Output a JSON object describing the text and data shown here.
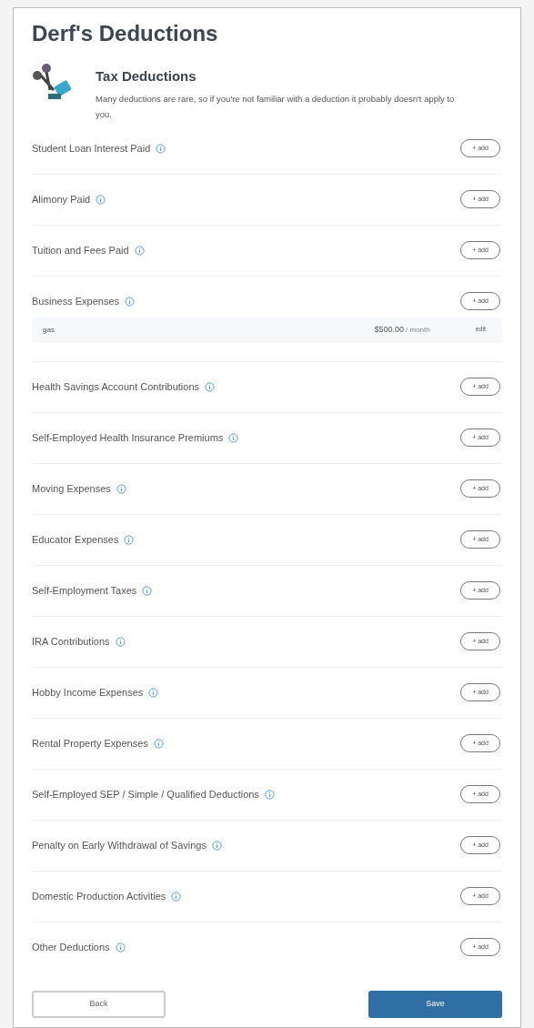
{
  "title": "Derf's Deductions",
  "section": {
    "title": "Tax Deductions",
    "description": "Many deductions are rare, so if you're not familiar with a deduction it probably doesn't apply to you."
  },
  "deductions": [
    {
      "label": "Student Loan Interest Paid",
      "button": "+ add"
    },
    {
      "label": "Alimony Paid",
      "button": "+ add"
    },
    {
      "label": "Tuition and Fees Paid",
      "button": "+ add"
    },
    {
      "label": "Business Expenses",
      "button": "+ add",
      "entries": [
        {
          "name": "gas",
          "amount": "$500.00",
          "period": "/ month",
          "action": "edit"
        }
      ]
    },
    {
      "label": "Health Savings Account Contributions",
      "button": "+ add"
    },
    {
      "label": "Self-Employed Health Insurance Premiums",
      "button": "+ add"
    },
    {
      "label": "Moving Expenses",
      "button": "+ add"
    },
    {
      "label": "Educator Expenses",
      "button": "+ add"
    },
    {
      "label": "Self-Employment Taxes",
      "button": "+ add"
    },
    {
      "label": "IRA Contributions",
      "button": "+ add"
    },
    {
      "label": "Hobby Income Expenses",
      "button": "+ add"
    },
    {
      "label": "Rental Property Expenses",
      "button": "+ add"
    },
    {
      "label": "Self-Employed SEP / Simple / Qualified Deductions",
      "button": "+ add"
    },
    {
      "label": "Penalty on Early Withdrawal of Savings",
      "button": "+ add"
    },
    {
      "label": "Domestic Production Activities",
      "button": "+ add"
    },
    {
      "label": "Other Deductions",
      "button": "+ add"
    }
  ],
  "buttons": {
    "back": "Back",
    "save": "Save"
  }
}
